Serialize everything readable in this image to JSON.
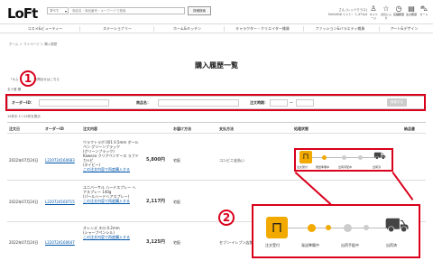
{
  "header": {
    "logo": "LoFt",
    "category_select": "すべて",
    "search_placeholder": "商品名・商品番号・キーワードで検索",
    "detail_search": "詳細検索",
    "user_line1": "さん (レッドクラス)",
    "user_line2": "Smiloftポイント：1,471pt",
    "icons": [
      {
        "name": "mypage-icon",
        "label": "マイページ",
        "glyph": "♙"
      },
      {
        "name": "favorite-icon",
        "label": "お気に入り",
        "glyph": "☆"
      },
      {
        "name": "history-icon",
        "label": "店舗履歴",
        "glyph": "◷"
      },
      {
        "name": "order-icon",
        "label": "注文履歴",
        "glyph": "▤"
      },
      {
        "name": "cart-icon",
        "label": "カート",
        "glyph": "⛍"
      }
    ]
  },
  "nav": [
    "コスメ&ビューティー",
    "ステーショナリー",
    "ホーム&キッチン",
    "キャラクター・クリエイター雑貨",
    "ファッション&バラエティ雑貨",
    "アート&デザイン"
  ],
  "breadcrumb": "ホーム ＞ マイページ ＞ 購入履歴",
  "page_title": "購入履歴一覧",
  "notes": {
    "line1": "「オム　　　　」お問合せはこちら",
    "line2": "五十音 順"
  },
  "filter": {
    "order_id_label": "オーダーID：",
    "product_label": "商品名：",
    "date_label": "注文時期：",
    "date_sep": "〜",
    "search_button": "検索する"
  },
  "result_count": "15件中 1〜15件を表示",
  "callouts": {
    "one": "1",
    "two": "2"
  },
  "columns": [
    "注文日",
    "オーダーID",
    "注文内容",
    "",
    "お届け方法",
    "支払方法",
    "処理状態",
    "",
    "",
    "",
    "納品書"
  ],
  "orders": [
    {
      "date": "2022年07月24日",
      "order_id": "L220724160683",
      "content": [
        "ウラフトラボ 001 0.5mm ボールペン グリーンブラック",
        "(グリーンブラック)",
        "Kaweco クリアペンケース ラブドカ×ピ",
        "(ネイビー)"
      ],
      "reorder": "この注文内容で再度購入する",
      "price": "5,800円",
      "delivery": "宅配",
      "payment": "コンビニ支払い"
    },
    {
      "date": "2022年07月24日",
      "order_id": "L220724160715",
      "content": [
        "ユニバーサル ハードスプレー ヘアスプレー 140g",
        "(パールハードヘアスプレー)"
      ],
      "reorder": "この注文内容で再度購入する",
      "price": "2,117円",
      "delivery": "宅配",
      "payment": ""
    },
    {
      "date": "2022年07月24日",
      "order_id": "L220724160647",
      "content": [
        "オレンズ ネロ 0.2mm",
        "(シャープペンシル)"
      ],
      "reorder": "この注文内容で再度購入する",
      "price": "3,125円",
      "delivery": "宅配",
      "payment": "セブン-イレブン店舗受取り"
    }
  ],
  "status_steps": [
    "注文受付",
    "発送準備中",
    "出荷手配中",
    "出荷済"
  ],
  "colors": {
    "accent_red": "#d9001b",
    "status_active": "#f2a900",
    "status_inactive": "#cccccc"
  }
}
